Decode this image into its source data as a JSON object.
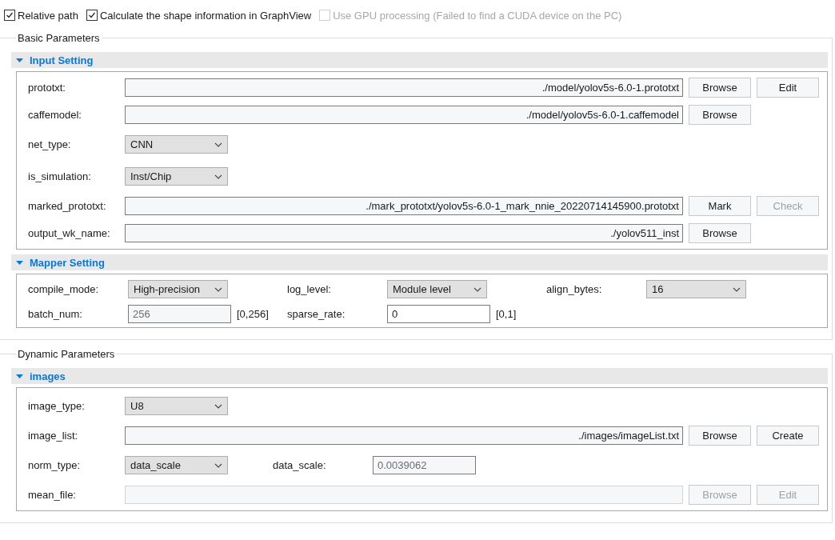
{
  "options": [
    {
      "label": "Relative path",
      "checked": true,
      "disabled": false
    },
    {
      "label": "Calculate the shape information in GraphView",
      "checked": true,
      "disabled": false
    },
    {
      "label": "Use GPU processing (Failed to find a CUDA device on the PC)",
      "checked": false,
      "disabled": true
    }
  ],
  "groups": [
    {
      "title": "Basic Parameters",
      "sections": [
        {
          "title": "Input Setting",
          "expanded": true,
          "kind": "rows",
          "rows": [
            {
              "fields": [
                {
                  "kind": "path",
                  "label": "prototxt:",
                  "value": "./model/yolov5s-6.0-1.prototxt",
                  "disabled": false,
                  "buttons": [
                    {
                      "label": "Browse",
                      "disabled": false
                    },
                    {
                      "label": "Edit",
                      "disabled": false
                    }
                  ]
                }
              ]
            },
            {
              "fields": [
                {
                  "kind": "path",
                  "label": "caffemodel:",
                  "value": "./model/yolov5s-6.0-1.caffemodel",
                  "disabled": false,
                  "buttons": [
                    {
                      "label": "Browse",
                      "disabled": false
                    }
                  ]
                }
              ]
            },
            {
              "fields": [
                {
                  "kind": "select",
                  "label": "net_type:",
                  "value": "CNN"
                }
              ]
            },
            {
              "fields": [
                {
                  "kind": "select",
                  "label": "is_simulation:",
                  "value": "Inst/Chip"
                }
              ]
            },
            {
              "fields": [
                {
                  "kind": "path",
                  "label": "marked_prototxt:",
                  "value": "./mark_prototxt/yolov5s-6.0-1_mark_nnie_20220714145900.prototxt",
                  "disabled": false,
                  "buttons": [
                    {
                      "label": "Mark",
                      "disabled": false
                    },
                    {
                      "label": "Check",
                      "disabled": true
                    }
                  ]
                }
              ]
            },
            {
              "fields": [
                {
                  "kind": "path",
                  "label": "output_wk_name:",
                  "value": "./yolov511_inst",
                  "disabled": false,
                  "buttons": [
                    {
                      "label": "Browse",
                      "disabled": false
                    }
                  ]
                }
              ]
            }
          ]
        },
        {
          "title": "Mapper Setting",
          "expanded": true,
          "kind": "compact",
          "rows": [
            {
              "fields": [
                {
                  "kind": "select",
                  "label": "compile_mode:",
                  "value": "High-precision"
                },
                {
                  "kind": "select",
                  "label": "log_level:",
                  "value": "Module level"
                },
                {
                  "kind": "select",
                  "label": "align_bytes:",
                  "value": "16"
                }
              ]
            },
            {
              "fields": [
                {
                  "kind": "text",
                  "label": "batch_num:",
                  "value": "256",
                  "readonly": true,
                  "range": "[0,256]"
                },
                {
                  "kind": "text",
                  "label": "sparse_rate:",
                  "value": "0",
                  "readonly": false,
                  "range": "[0,1]"
                }
              ]
            }
          ]
        }
      ]
    },
    {
      "title": "Dynamic Parameters",
      "sections": [
        {
          "title": "images",
          "expanded": true,
          "kind": "rows",
          "rows": [
            {
              "fields": [
                {
                  "kind": "select",
                  "label": "image_type:",
                  "value": "U8"
                }
              ]
            },
            {
              "fields": [
                {
                  "kind": "path",
                  "label": "image_list:",
                  "value": "./images/imageList.txt",
                  "disabled": false,
                  "buttons": [
                    {
                      "label": "Browse",
                      "disabled": false
                    },
                    {
                      "label": "Create",
                      "disabled": false
                    }
                  ]
                }
              ]
            },
            {
              "fields": [
                {
                  "kind": "select",
                  "label": "norm_type:",
                  "value": "data_scale"
                },
                {
                  "kind": "text",
                  "label": "data_scale:",
                  "value": "0.0039062",
                  "readonly": true
                }
              ]
            },
            {
              "fields": [
                {
                  "kind": "path",
                  "label": "mean_file:",
                  "disabled": true,
                  "buttons": [
                    {
                      "label": "Browse",
                      "disabled": true
                    },
                    {
                      "label": "Edit",
                      "disabled": true
                    }
                  ]
                }
              ]
            }
          ]
        }
      ]
    }
  ]
}
